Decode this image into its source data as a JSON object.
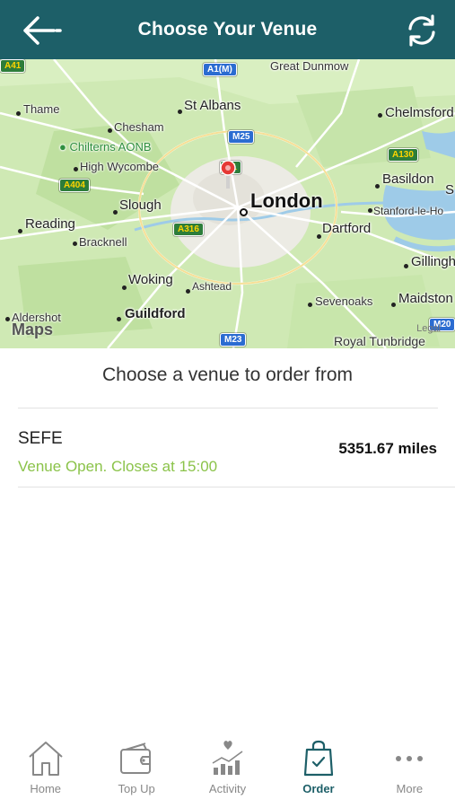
{
  "header": {
    "title": "Choose Your Venue",
    "back_icon": "arrow-left-icon",
    "refresh_icon": "refresh-icon"
  },
  "map": {
    "places": {
      "thame": "Thame",
      "st_albans": "St Albans",
      "great_dunmow": "Great Dunmow",
      "chelmsford": "Chelmsford",
      "chesham": "Chesham",
      "chilterns": "Chilterns AONB",
      "high_wycombe": "High Wycombe",
      "slough": "Slough",
      "london": "London",
      "basildon": "Basildon",
      "stanford": "Stanford-le-Ho",
      "s_edge": "S",
      "reading": "Reading",
      "bracknell": "Bracknell",
      "dartford": "Dartford",
      "gillingham": "Gillingh",
      "woking": "Woking",
      "ashtead": "Ashtead",
      "sevenoaks": "Sevenoaks",
      "maidstone": "Maidston",
      "aldershot": "Aldershot",
      "guildford": "Guildford",
      "tunbridge": "Royal Tunbridge"
    },
    "roads": {
      "a41": "A41",
      "a1m": "A1(M)",
      "m25": "M25",
      "a404": "A404",
      "m1": "M1",
      "a130": "A130",
      "a316": "A316",
      "m23": "M23",
      "m20": "M20"
    },
    "attribution": "Maps",
    "legal": "Legal"
  },
  "subtitle": "Choose a venue to order from",
  "venues": [
    {
      "name": "SEFE",
      "status": "Venue Open. Closes at 15:00",
      "distance": "5351.67 miles"
    }
  ],
  "tabs": [
    {
      "label": "Home",
      "icon": "home-icon",
      "active": false
    },
    {
      "label": "Top Up",
      "icon": "wallet-icon",
      "active": false
    },
    {
      "label": "Activity",
      "icon": "activity-chart-icon",
      "active": false
    },
    {
      "label": "Order",
      "icon": "shopping-bag-icon",
      "active": true
    },
    {
      "label": "More",
      "icon": "more-dots-icon",
      "active": false
    }
  ],
  "colors": {
    "header": "#1d5f68",
    "open_status": "#8bc34a",
    "active_tab": "#1d5f68",
    "inactive_tab": "#888888"
  }
}
